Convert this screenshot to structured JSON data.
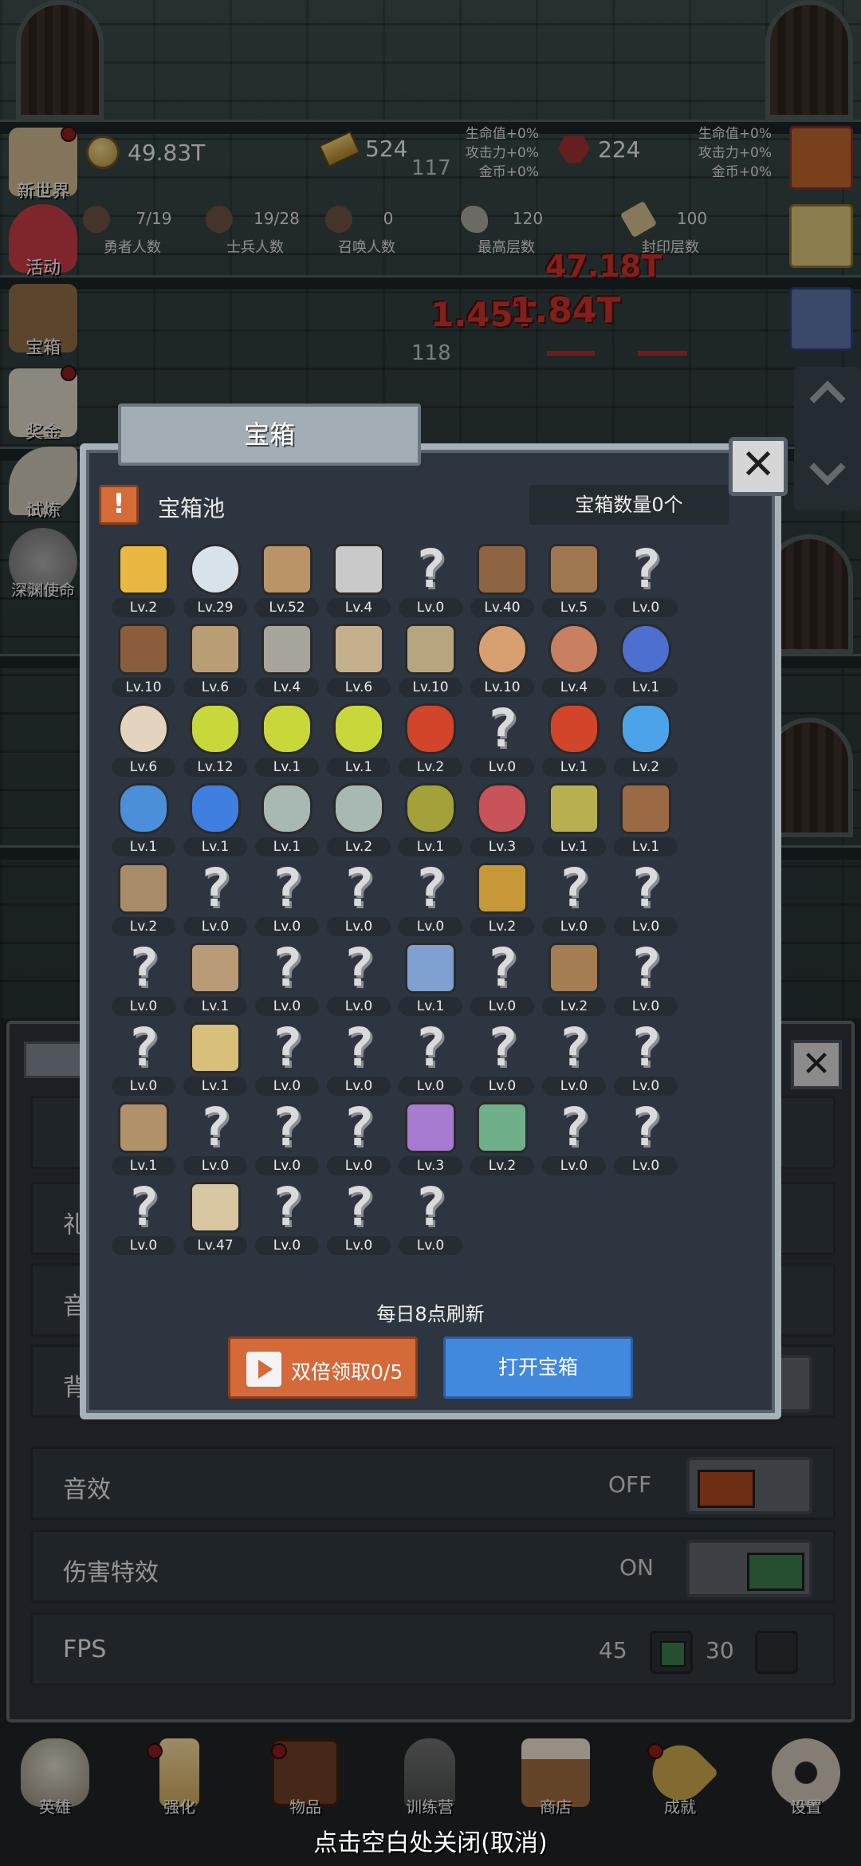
{
  "top_bar": {
    "gold": "49.83T",
    "gold_bar": "524",
    "gem": "224",
    "floor_label_left": "117",
    "bonus_left": [
      "生命值+0%",
      "攻击力+0%",
      "金币+0%"
    ],
    "bonus_right": [
      "生命值+0%",
      "攻击力+0%",
      "金币+0%"
    ],
    "stats": [
      {
        "value": "7/19",
        "label": "勇者人数"
      },
      {
        "value": "19/28",
        "label": "士兵人数"
      },
      {
        "value": "0",
        "label": "召唤人数"
      },
      {
        "value": "120",
        "label": "最高层数"
      },
      {
        "value": "100",
        "label": "封印层数"
      }
    ]
  },
  "battle": {
    "damage_1": "47.18T",
    "damage_2": "1.45T",
    "damage_3": "1.84T",
    "floor_label": "118"
  },
  "side_menu": [
    {
      "label": "新世界",
      "icon": "map-scroll-icon",
      "dot": true
    },
    {
      "label": "活动",
      "icon": "heart-icon",
      "dot": false
    },
    {
      "label": "宝箱",
      "icon": "chest-icon",
      "dot": false
    },
    {
      "label": "奖金",
      "icon": "envelope-icon",
      "dot": true
    },
    {
      "label": "试炼",
      "icon": "feather-icon",
      "dot": false
    },
    {
      "label": "深渊使命",
      "icon": "orb-icon",
      "dot": false
    }
  ],
  "settings_bg": {
    "rows": [
      {
        "label": "音效",
        "state": "OFF"
      },
      {
        "label": "伤害特效",
        "state": "ON"
      },
      {
        "label": "FPS",
        "opt1": "45",
        "opt2": "30"
      }
    ],
    "partial_labels": [
      "礼",
      "音",
      "背"
    ]
  },
  "modal": {
    "title": "宝箱",
    "pool_title": "宝箱池",
    "chest_count": "宝箱数量0个",
    "refresh_note": "每日8点刷新",
    "double_button": "双倍领取0/5",
    "open_button": "打开宝箱",
    "items": [
      {
        "icon": "crown-icon",
        "level": "Lv.2"
      },
      {
        "icon": "diamond-icon",
        "level": "Lv.29"
      },
      {
        "icon": "wooden-sword-icon",
        "level": "Lv.52"
      },
      {
        "icon": "iron-sword-icon",
        "level": "Lv.4"
      },
      {
        "icon": "unknown-icon",
        "level": "Lv.0"
      },
      {
        "icon": "leather-armor-icon",
        "level": "Lv.40"
      },
      {
        "icon": "leather-vest-icon",
        "level": "Lv.5"
      },
      {
        "icon": "unknown-icon",
        "level": "Lv.0"
      },
      {
        "icon": "leather-helmet-icon",
        "level": "Lv.10"
      },
      {
        "icon": "dagger-icon",
        "level": "Lv.6"
      },
      {
        "icon": "knight-helmet-icon",
        "level": "Lv.4"
      },
      {
        "icon": "hammer-icon",
        "level": "Lv.6"
      },
      {
        "icon": "great-helm-icon",
        "level": "Lv.10"
      },
      {
        "icon": "meat-icon",
        "level": "Lv.10"
      },
      {
        "icon": "steak-icon",
        "level": "Lv.4"
      },
      {
        "icon": "pouch-icon",
        "level": "Lv.1"
      },
      {
        "icon": "bread-icon",
        "level": "Lv.6"
      },
      {
        "icon": "yellow-potion-icon",
        "level": "Lv.12"
      },
      {
        "icon": "yellow-potion-icon",
        "level": "Lv.1"
      },
      {
        "icon": "yellow-potion-icon",
        "level": "Lv.1"
      },
      {
        "icon": "red-potion-icon",
        "level": "Lv.2"
      },
      {
        "icon": "unknown-icon",
        "level": "Lv.0"
      },
      {
        "icon": "red-potion-icon",
        "level": "Lv.1"
      },
      {
        "icon": "blue-potion-icon",
        "level": "Lv.2"
      },
      {
        "icon": "blue-jar-icon",
        "level": "Lv.1"
      },
      {
        "icon": "blue-flask-icon",
        "level": "Lv.1"
      },
      {
        "icon": "gray-bottle-icon",
        "level": "Lv.1"
      },
      {
        "icon": "gray-bottle-icon",
        "level": "Lv.2"
      },
      {
        "icon": "olive-bottle-icon",
        "level": "Lv.1"
      },
      {
        "icon": "red-bottle-icon",
        "level": "Lv.3"
      },
      {
        "icon": "winged-boot-icon",
        "level": "Lv.1"
      },
      {
        "icon": "leather-boot-icon",
        "level": "Lv.1"
      },
      {
        "icon": "shoe-icon",
        "level": "Lv.2"
      },
      {
        "icon": "unknown-icon",
        "level": "Lv.0"
      },
      {
        "icon": "unknown-icon",
        "level": "Lv.0"
      },
      {
        "icon": "unknown-icon",
        "level": "Lv.0"
      },
      {
        "icon": "unknown-icon",
        "level": "Lv.0"
      },
      {
        "icon": "torch-icon",
        "level": "Lv.2"
      },
      {
        "icon": "unknown-icon",
        "level": "Lv.0"
      },
      {
        "icon": "unknown-icon",
        "level": "Lv.0"
      },
      {
        "icon": "unknown-icon",
        "level": "Lv.0"
      },
      {
        "icon": "staff-icon",
        "level": "Lv.1"
      },
      {
        "icon": "unknown-icon",
        "level": "Lv.0"
      },
      {
        "icon": "unknown-icon",
        "level": "Lv.0"
      },
      {
        "icon": "wand-icon",
        "level": "Lv.1"
      },
      {
        "icon": "unknown-icon",
        "level": "Lv.0"
      },
      {
        "icon": "backpack-icon",
        "level": "Lv.2"
      },
      {
        "icon": "unknown-icon",
        "level": "Lv.0"
      },
      {
        "icon": "unknown-icon",
        "level": "Lv.0"
      },
      {
        "icon": "golden-blade-icon",
        "level": "Lv.1"
      },
      {
        "icon": "unknown-icon",
        "level": "Lv.0"
      },
      {
        "icon": "unknown-icon",
        "level": "Lv.0"
      },
      {
        "icon": "unknown-icon",
        "level": "Lv.0"
      },
      {
        "icon": "unknown-icon",
        "level": "Lv.0"
      },
      {
        "icon": "unknown-icon",
        "level": "Lv.0"
      },
      {
        "icon": "unknown-icon",
        "level": "Lv.0"
      },
      {
        "icon": "bow-icon",
        "level": "Lv.1"
      },
      {
        "icon": "unknown-icon",
        "level": "Lv.0"
      },
      {
        "icon": "unknown-icon",
        "level": "Lv.0"
      },
      {
        "icon": "unknown-icon",
        "level": "Lv.0"
      },
      {
        "icon": "tentacle-icon",
        "level": "Lv.3"
      },
      {
        "icon": "emblem-shield-icon",
        "level": "Lv.2"
      },
      {
        "icon": "unknown-icon",
        "level": "Lv.0"
      },
      {
        "icon": "unknown-icon",
        "level": "Lv.0"
      },
      {
        "icon": "unknown-icon",
        "level": "Lv.0"
      },
      {
        "icon": "ale-mug-icon",
        "level": "Lv.47"
      },
      {
        "icon": "unknown-icon",
        "level": "Lv.0"
      },
      {
        "icon": "unknown-icon",
        "level": "Lv.0"
      },
      {
        "icon": "unknown-icon",
        "level": "Lv.0"
      }
    ]
  },
  "bottom_nav": [
    {
      "label": "英雄",
      "icon": "skull-icon",
      "dot": false
    },
    {
      "label": "强化",
      "icon": "candle-icon",
      "dot": true
    },
    {
      "label": "物品",
      "icon": "book-icon",
      "dot": true
    },
    {
      "label": "训练营",
      "icon": "lantern-icon",
      "dot": false
    },
    {
      "label": "商店",
      "icon": "mug-icon",
      "dot": false
    },
    {
      "label": "成就",
      "icon": "key-icon",
      "dot": true
    },
    {
      "label": "设置",
      "icon": "gear-icon",
      "dot": false
    }
  ],
  "close_hint": "点击空白处关闭(取消)",
  "colors": {
    "accent_orange": "#d4693a",
    "accent_blue": "#4289dd",
    "toggle_off": "#a9481f",
    "toggle_on": "#3a7a4a"
  }
}
